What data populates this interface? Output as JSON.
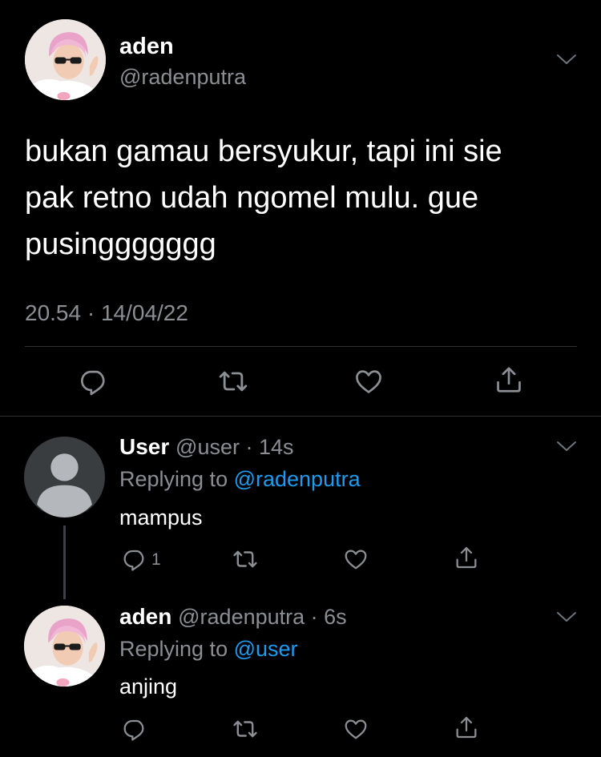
{
  "main_tweet": {
    "display_name": "aden",
    "handle": "@radenputra",
    "text": "bukan gamau bersyukur, tapi ini sie\npak retno udah ngomel mulu. gue\npusinggggggg",
    "meta": "20.54 · 14/04/22"
  },
  "replies": [
    {
      "display_name": "User",
      "handle_time": "@user · 14s",
      "replying_prefix": "Replying to ",
      "replying_to": "@radenputra",
      "text": "mampus",
      "reply_count": "1",
      "avatar": "default-person-icon"
    },
    {
      "display_name": "aden",
      "handle_time": "@radenputra · 6s",
      "replying_prefix": "Replying to ",
      "replying_to": "@user",
      "text": "anjing",
      "reply_count": "",
      "avatar": "profile-photo"
    }
  ],
  "icons": {
    "reply": "reply-icon",
    "retweet": "retweet-icon",
    "like": "heart-icon",
    "share": "share-icon",
    "more": "chevron-down-icon"
  },
  "colors": {
    "background": "#000000",
    "text": "#ffffff",
    "secondary_text": "#8b8f94",
    "link": "#1d9bf0",
    "divider": "#2f3336"
  }
}
